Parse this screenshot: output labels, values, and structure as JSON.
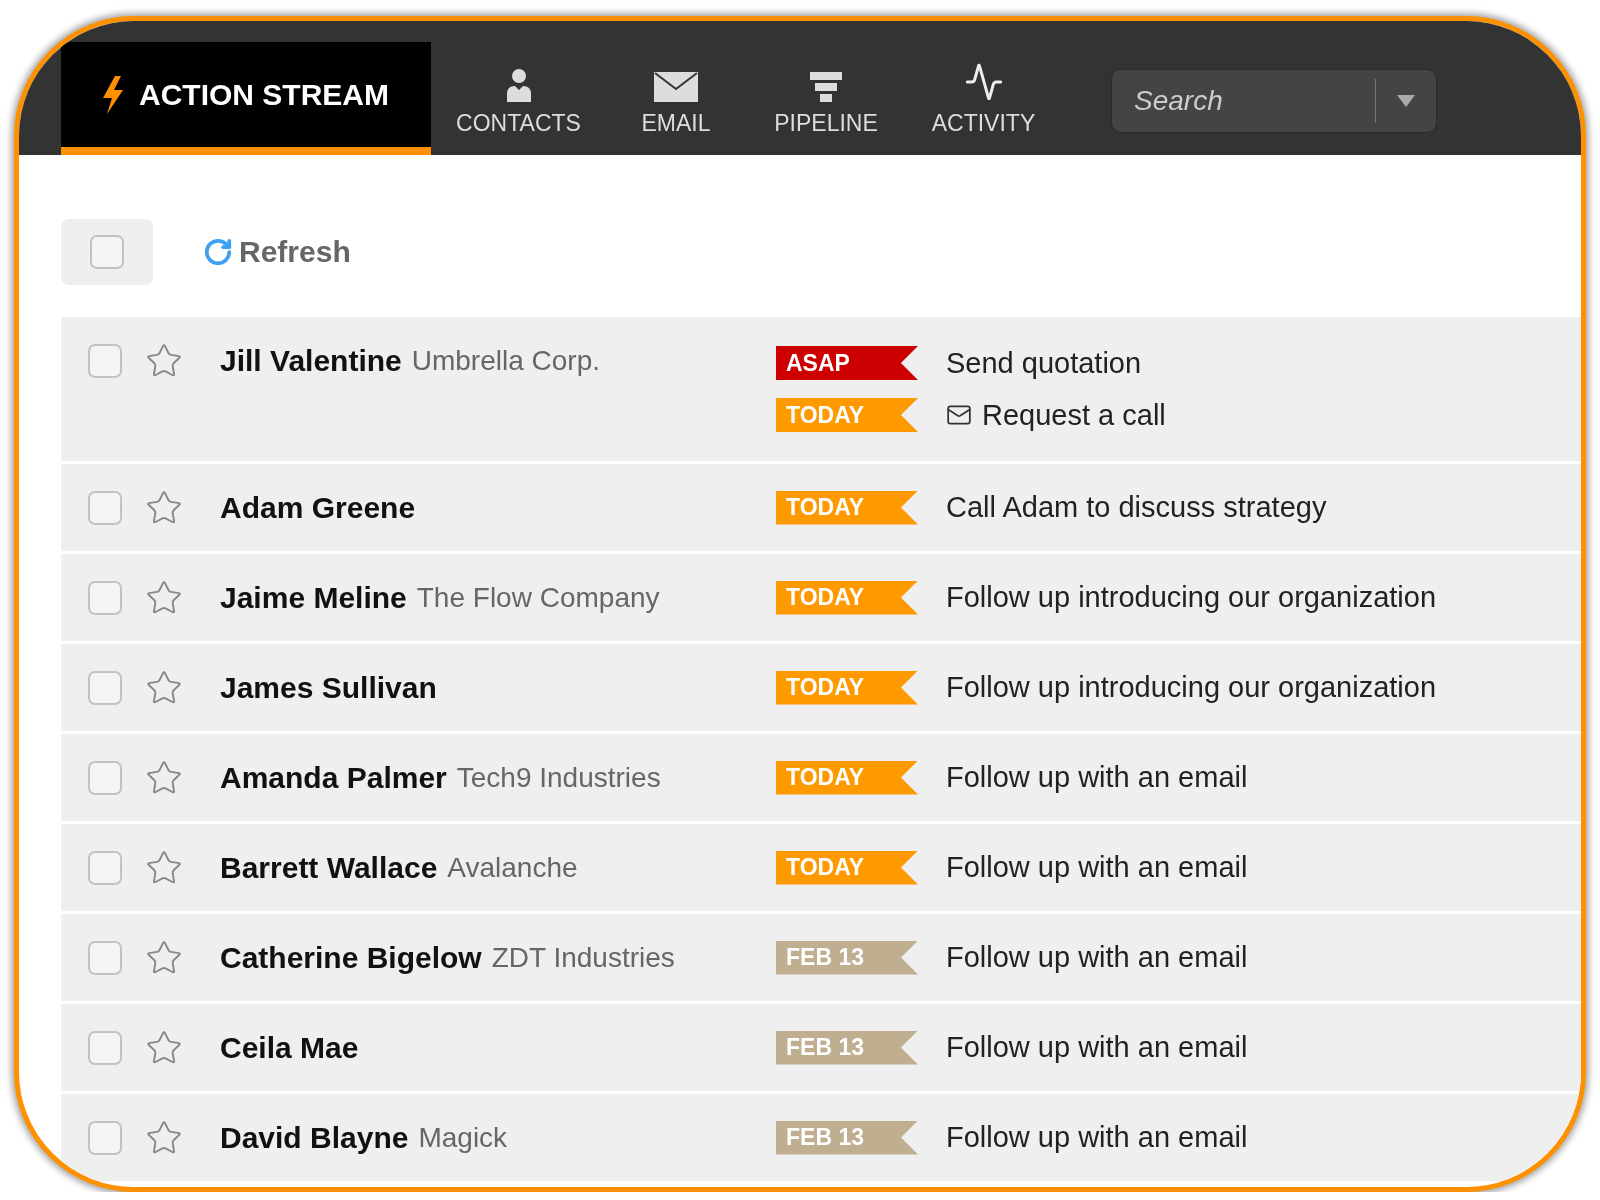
{
  "nav": {
    "brand": {
      "label": "ACTION STREAM",
      "selected": true
    },
    "tabs": [
      {
        "label": "CONTACTS",
        "kind": "person",
        "selected": false
      },
      {
        "label": "EMAIL",
        "kind": "mail",
        "selected": false
      },
      {
        "label": "PIPELINE",
        "kind": "funnel",
        "selected": false
      },
      {
        "label": "ACTIVITY",
        "kind": "pulse",
        "selected": false
      }
    ]
  },
  "search": {
    "placeholder": "Search"
  },
  "toolbar": {
    "select_all": {
      "checked": false
    },
    "refresh": "Refresh"
  },
  "rows": [
    {
      "name": "Jill Valentine",
      "company": "Umbrella Corp.",
      "checked": false,
      "starred": false,
      "tasks": [
        {
          "tag": "ASAP",
          "color": "#cc0000",
          "text": "Send quotation",
          "kind": "plain"
        },
        {
          "tag": "TODAY",
          "color": "#ff9900",
          "text": "Request a call",
          "kind": "email"
        }
      ]
    },
    {
      "name": "Adam Greene",
      "checked": false,
      "starred": false,
      "tasks": [
        {
          "tag": "TODAY",
          "color": "#ff9900",
          "text": "Call Adam to discuss strategy",
          "kind": "plain"
        }
      ]
    },
    {
      "name": "Jaime Meline",
      "company": "The Flow Company",
      "checked": false,
      "starred": false,
      "tasks": [
        {
          "tag": "TODAY",
          "color": "#ff9900",
          "text": "Follow up introducing our organization",
          "kind": "plain"
        }
      ]
    },
    {
      "name": "James Sullivan",
      "checked": false,
      "starred": false,
      "tasks": [
        {
          "tag": "TODAY",
          "color": "#ff9900",
          "text": "Follow up introducing our organization",
          "kind": "plain"
        }
      ]
    },
    {
      "name": "Amanda Palmer",
      "company": "Tech9 Industries",
      "checked": false,
      "starred": false,
      "tasks": [
        {
          "tag": "TODAY",
          "color": "#ff9900",
          "text": "Follow up with an email",
          "kind": "plain"
        }
      ]
    },
    {
      "name": "Barrett Wallace",
      "company": "Avalanche",
      "checked": false,
      "starred": false,
      "tasks": [
        {
          "tag": "TODAY",
          "color": "#ff9900",
          "text": "Follow up with an email",
          "kind": "plain"
        }
      ]
    },
    {
      "name": "Catherine Bigelow",
      "company": "ZDT Industries",
      "checked": false,
      "starred": false,
      "tasks": [
        {
          "tag": "FEB 13",
          "color": "#bfae8f",
          "text": "Follow up with an email",
          "kind": "plain"
        }
      ]
    },
    {
      "name": "Ceila Mae",
      "checked": false,
      "starred": false,
      "tasks": [
        {
          "tag": "FEB 13",
          "color": "#bfae8f",
          "text": "Follow up with an email",
          "kind": "plain"
        }
      ]
    },
    {
      "name": "David Blayne",
      "company": "Magick",
      "checked": false,
      "starred": false,
      "tasks": [
        {
          "tag": "FEB 13",
          "color": "#bfae8f",
          "text": "Follow up with an email",
          "kind": "plain"
        }
      ]
    }
  ]
}
